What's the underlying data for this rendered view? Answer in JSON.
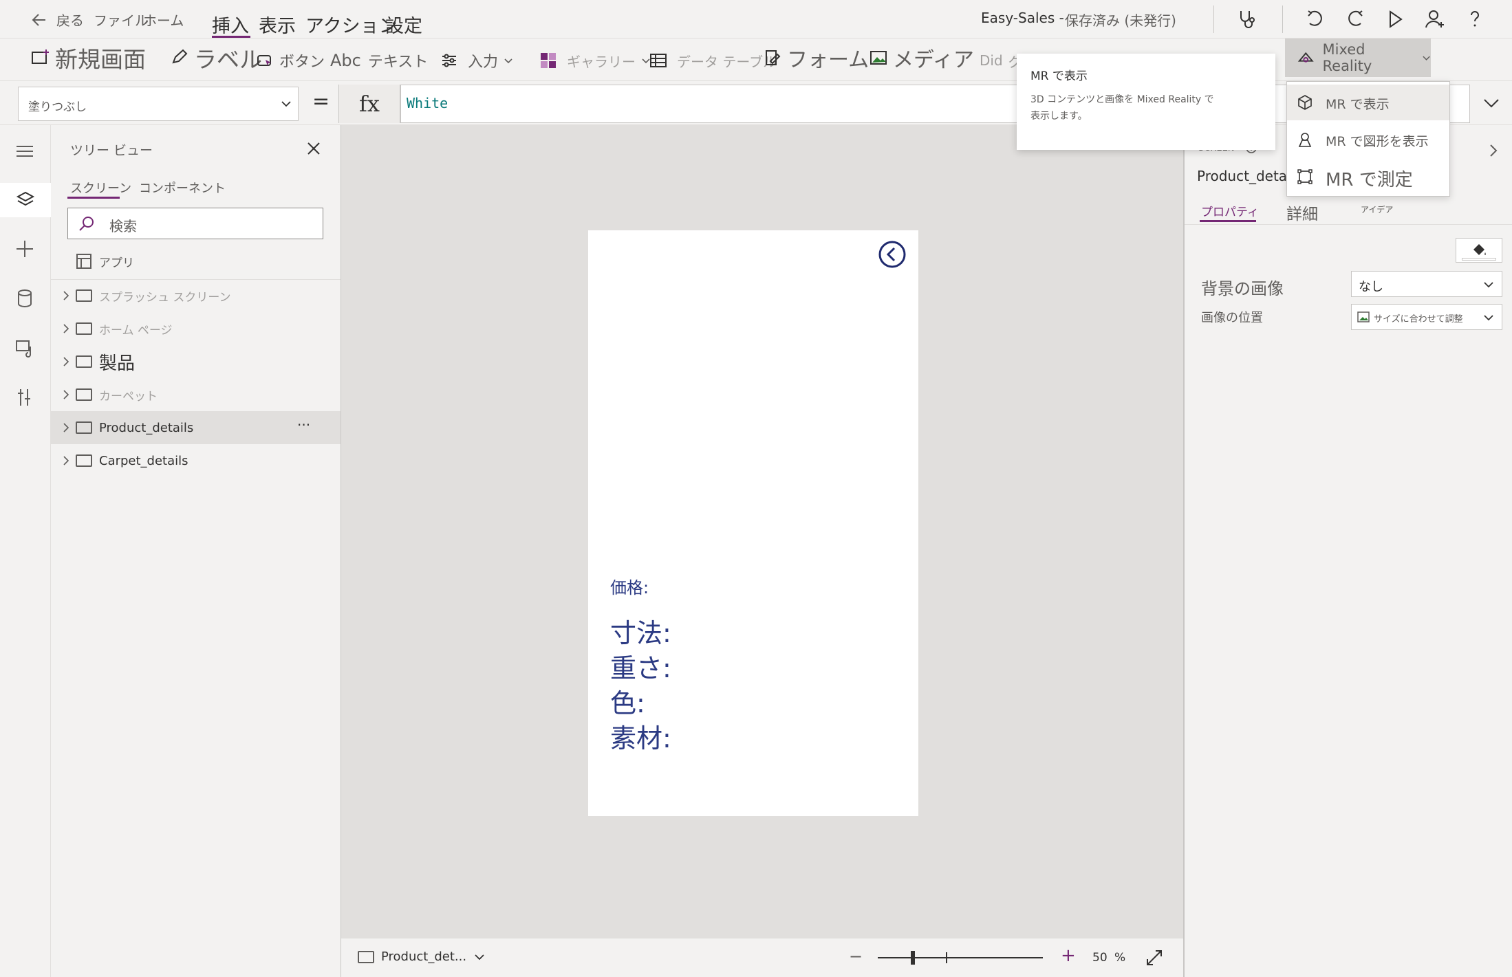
{
  "topbar": {
    "back_label": "戻る",
    "menu": [
      "ファイル",
      "ホーム"
    ],
    "tabs": [
      {
        "label": "挿入",
        "active": true
      },
      {
        "label": "表示",
        "active": false
      },
      {
        "label": "アクション",
        "active": false
      },
      {
        "label": "設定",
        "active": false
      }
    ],
    "app_name": "Easy-Sales -",
    "save_status": "保存済み (未発行)"
  },
  "ribbon": {
    "new_screen": "新規画面",
    "label": "ラベル",
    "button": "ボタン",
    "text_prefix": "Abc",
    "text": "テキスト",
    "input": "入力",
    "gallery": "ギャラリー",
    "data_table": "データ テーブル",
    "form": "フォーム",
    "media": "メディア",
    "chart_prefix": "Did",
    "chart": "グラフ",
    "mixed_reality": "Mixed Reality"
  },
  "formula": {
    "property": "塗りつぶし",
    "equals": "=",
    "fx": "fx",
    "value": "White"
  },
  "tree": {
    "title": "ツリー ビュー",
    "tabs": [
      {
        "label": "スクリーン",
        "active": true
      },
      {
        "label": "コンポーネント",
        "active": false
      }
    ],
    "search_placeholder": "検索",
    "app_item": "アプリ",
    "screens": [
      {
        "label": "スプラッシュ スクリーン",
        "selected": false
      },
      {
        "label": "ホーム ページ",
        "selected": false
      },
      {
        "label": "製品",
        "selected": false
      },
      {
        "label": "カーペット",
        "selected": false
      },
      {
        "label": "Product_details",
        "selected": true
      },
      {
        "label": "Carpet_details",
        "selected": false
      }
    ],
    "more_label": "···"
  },
  "canvas": {
    "screen_bg": "#ffffff",
    "labels": {
      "price": "価格:",
      "dimensions": "寸法:",
      "weight": "重さ:",
      "color": "色:",
      "material": "素材:"
    }
  },
  "status": {
    "screen_name": "Product_det...",
    "zoom_minus": "−",
    "zoom_plus": "+",
    "zoom_value": "50",
    "zoom_unit": "%",
    "zoom_fraction": 0.5
  },
  "rightpanel": {
    "section": "SCREEN",
    "screen_name": "Product_details",
    "tabs": [
      {
        "label": "プロパティ",
        "active": true
      },
      {
        "label": "詳細",
        "active": false
      },
      {
        "label": "アイデア",
        "active": false
      }
    ],
    "bg_image_label": "背景の画像",
    "bg_image_value": "なし",
    "image_position_label": "画像の位置",
    "image_position_value": "サイズに合わせて調整"
  },
  "tooltip": {
    "title": "MR で表示",
    "desc_line1": "3D コンテンツと画像を Mixed Reality で",
    "desc_line2": "表示します。"
  },
  "mr_menu": {
    "items": [
      {
        "label": "MR で表示",
        "icon": "cube-view-icon",
        "highlighted": true
      },
      {
        "label": "MR で図形を表示",
        "icon": "shape-view-icon",
        "highlighted": false
      },
      {
        "label": "MR で測定",
        "icon": "measure-icon",
        "highlighted": false
      }
    ]
  },
  "colors": {
    "accent": "#742774",
    "label_navy": "#2b3a83",
    "canvas_bg": "#e1dfdd",
    "formula_value": "#0a7a7a"
  }
}
